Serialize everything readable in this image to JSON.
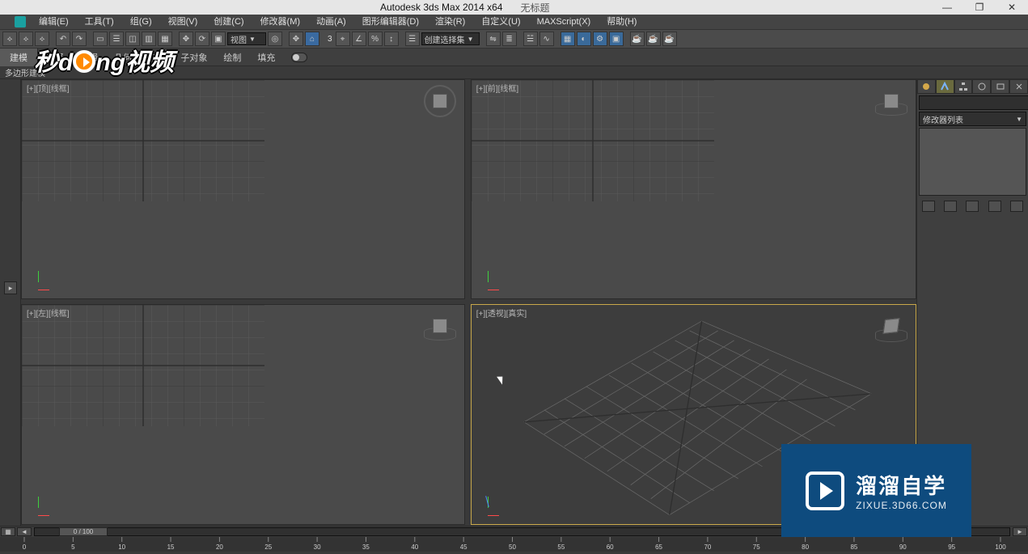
{
  "title": {
    "app": "Autodesk 3ds Max  2014 x64",
    "doc": "无标题"
  },
  "window_buttons": {
    "min": "—",
    "max": "❐",
    "close": "✕"
  },
  "menu": [
    "编辑(E)",
    "工具(T)",
    "组(G)",
    "视图(V)",
    "创建(C)",
    "修改器(M)",
    "动画(A)",
    "图形编辑器(D)",
    "渲染(R)",
    "自定义(U)",
    "MAXScript(X)",
    "帮助(H)"
  ],
  "toolbar": {
    "combo_view": "视图",
    "three": "3",
    "combo_selset": "创建选择集"
  },
  "ribbon": {
    "tab_active": "建模",
    "groups": [
      "选择",
      "编辑",
      "几何体(全部)",
      "子对象",
      "绘制",
      "填充"
    ]
  },
  "subbar": {
    "label": "多边形建模"
  },
  "viewports": {
    "top": "[+][顶][线框]",
    "front": "[+][前][线框]",
    "left": "[+][左][线框]",
    "persp": "[+][透视][真实]"
  },
  "cmd_panel": {
    "name_value": "",
    "modifier_list": "修改器列表"
  },
  "timeline": {
    "range": "0 / 100"
  },
  "ticks": [
    "0",
    "5",
    "10",
    "15",
    "20",
    "25",
    "30",
    "35",
    "40",
    "45",
    "50",
    "55",
    "60",
    "65",
    "70",
    "75",
    "80",
    "85",
    "90",
    "95",
    "100"
  ],
  "watermark1": {
    "a": "秒d",
    "b": "ng视频"
  },
  "watermark2": {
    "line1": "溜溜自学",
    "line2": "ZIXUE.3D66.COM"
  }
}
